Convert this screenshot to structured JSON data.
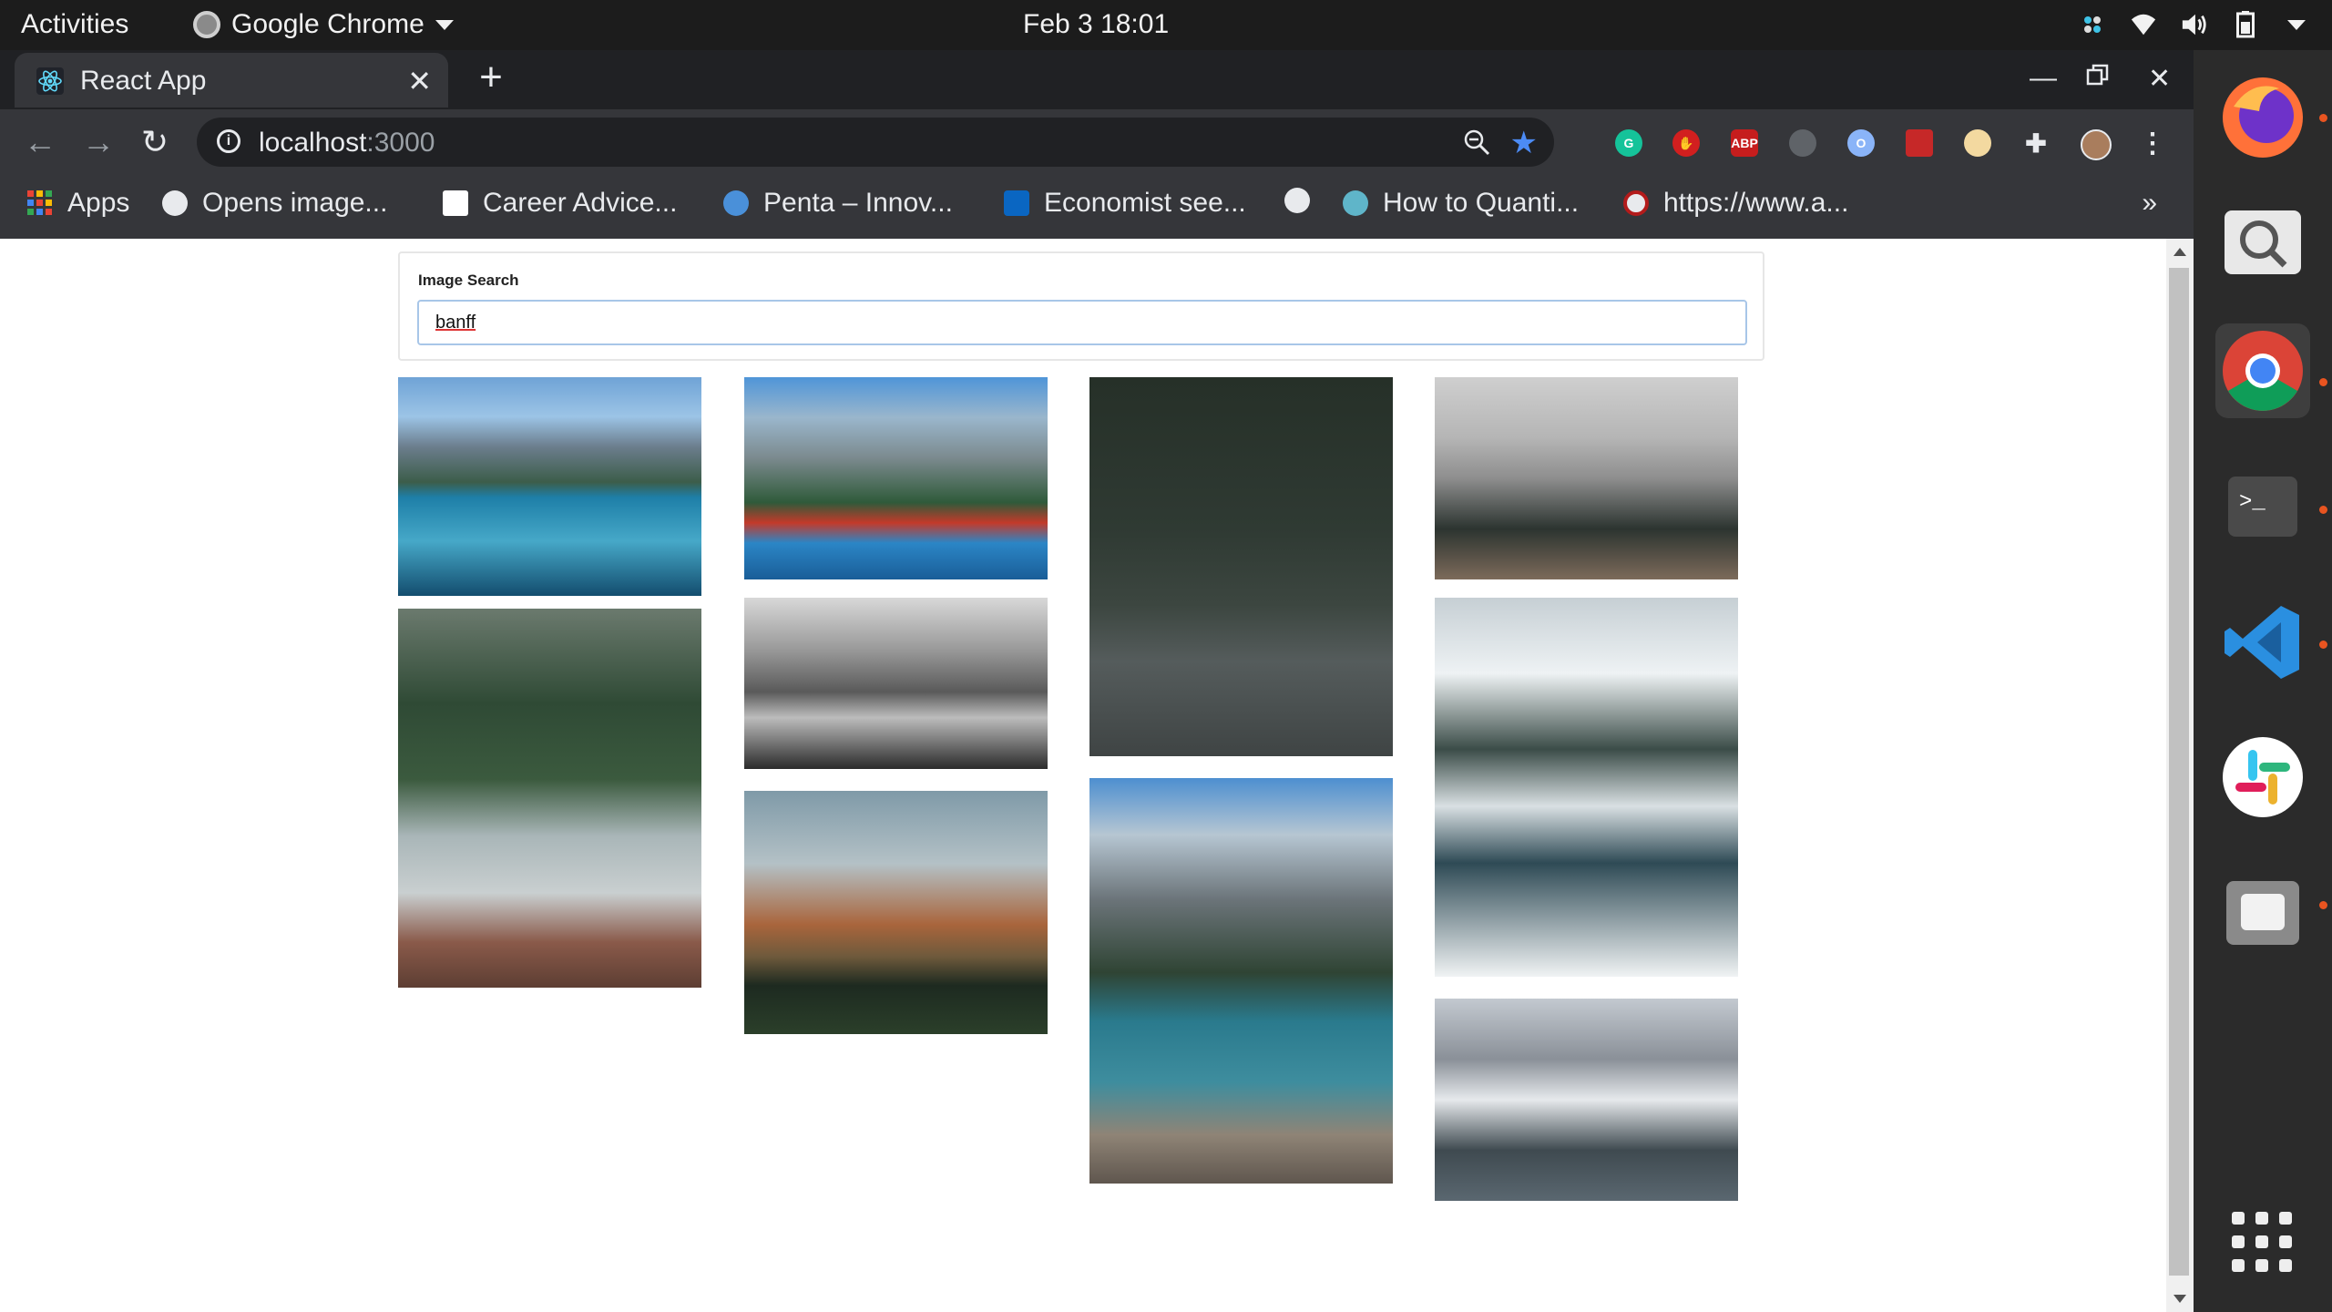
{
  "system_bar": {
    "activities": "Activities",
    "app_name": "Google Chrome",
    "clock": "Feb 3  18:01"
  },
  "browser": {
    "tab": {
      "title": "React App"
    },
    "address": {
      "host": "localhost",
      "port": ":3000"
    },
    "bookmarks": [
      {
        "label": "Apps",
        "icon": "apps-grid-icon"
      },
      {
        "label": "Opens image...",
        "icon": "globe-icon"
      },
      {
        "label": "Career Advice...",
        "icon": "career-site-icon"
      },
      {
        "label": "Penta – Innov...",
        "icon": "penta-icon"
      },
      {
        "label": "Economist see...",
        "icon": "linkedin-icon"
      },
      {
        "label": "",
        "icon": "globe-icon"
      },
      {
        "label": "How to Quanti...",
        "icon": "medium-icon"
      },
      {
        "label": "https://www.a...",
        "icon": "arxiv-icon"
      }
    ],
    "bookmarks_more": "»"
  },
  "search": {
    "label": "Image Search",
    "value": "banff"
  },
  "results": {
    "images": [
      {
        "alt": "moraine-lake-reflection"
      },
      {
        "alt": "forest-waterfall"
      },
      {
        "alt": "canoes-at-moraine-lake"
      },
      {
        "alt": "misty-peaks-bw"
      },
      {
        "alt": "mountain-at-dusk"
      },
      {
        "alt": "dark-forest-road"
      },
      {
        "alt": "lake-with-canoes-and-rocks"
      },
      {
        "alt": "snowy-mountain-forest"
      },
      {
        "alt": "snowy-river-hiker"
      },
      {
        "alt": "snow-covered-peaks"
      }
    ]
  },
  "colors": {
    "accent": "#4c8bf5",
    "ubuntu_orange": "#e95420",
    "chrome_dark": "#35363a"
  }
}
